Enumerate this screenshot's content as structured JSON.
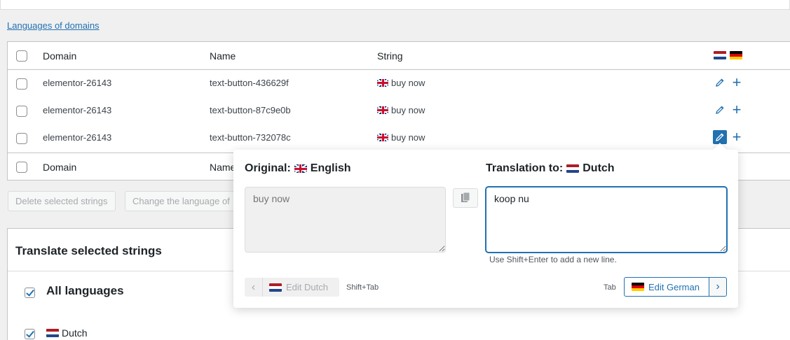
{
  "link": {
    "languages_of_domains": "Languages of domains"
  },
  "table": {
    "headers": {
      "domain": "Domain",
      "name": "Name",
      "string": "String"
    },
    "rows": [
      {
        "domain": "elementor-26143",
        "name": "text-button-436629f",
        "string": "buy now"
      },
      {
        "domain": "elementor-26143",
        "name": "text-button-87c9e0b",
        "string": "buy now"
      },
      {
        "domain": "elementor-26143",
        "name": "text-button-732078c",
        "string": "buy now"
      }
    ],
    "footer": {
      "domain": "Domain",
      "name": "Name"
    },
    "lang_flags": [
      "nl-flag",
      "de-flag"
    ]
  },
  "actions": {
    "delete_selected": "Delete selected strings",
    "change_language": "Change the language of"
  },
  "translate_panel": {
    "title": "Translate selected strings",
    "all_languages": "All languages",
    "dutch": "Dutch"
  },
  "popup": {
    "original_label": "Original:",
    "original_lang": "English",
    "translation_label": "Translation to:",
    "translation_lang": "Dutch",
    "original_placeholder": "buy now",
    "translation_value": "koop nu",
    "hint": "Use Shift+Enter to add a new line.",
    "prev_label": "Edit Dutch",
    "prev_shortcut": "Shift+Tab",
    "next_shortcut": "Tab",
    "next_label": "Edit German"
  },
  "colors": {
    "accent": "#2271b1",
    "background": "#f0f0f1"
  }
}
